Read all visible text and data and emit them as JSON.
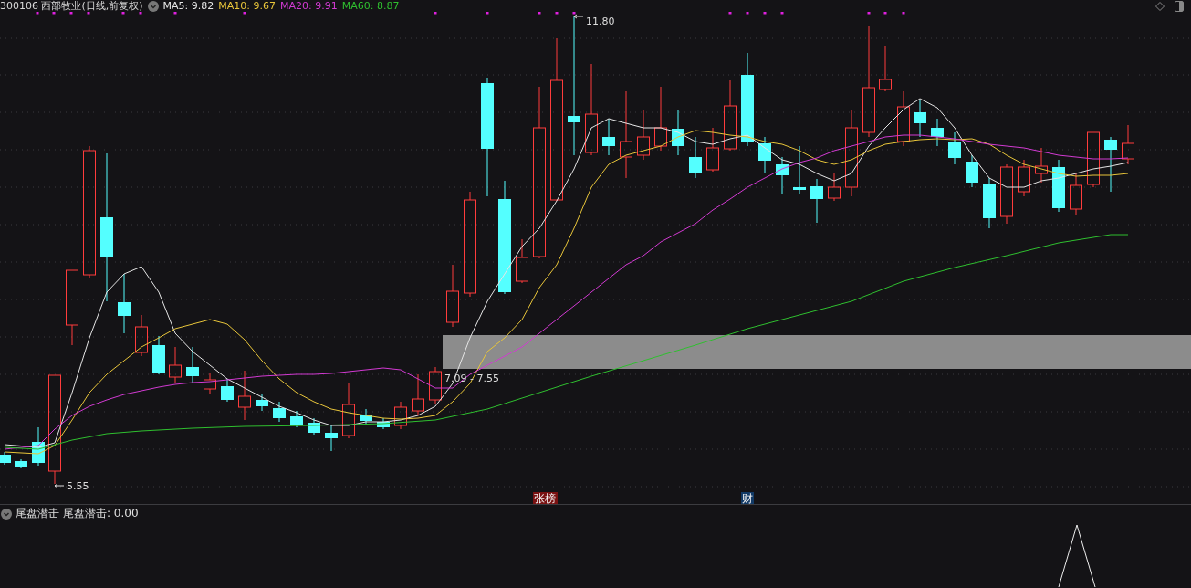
{
  "header": {
    "title": "300106 西部牧业(日线,前复权)",
    "indicators": [
      {
        "label": "MA5: 9.82",
        "color": "#e6e6e6"
      },
      {
        "label": "MA10: 9.67",
        "color": "#e8c53a"
      },
      {
        "label": "MA20: 9.91",
        "color": "#d23ad2"
      },
      {
        "label": "MA60: 8.87",
        "color": "#2fbf2f"
      }
    ]
  },
  "chart": {
    "high_label": "11.80",
    "low_label": "5.55",
    "range_label": "7.09 - 7.55",
    "markers": [
      {
        "text": "张榜",
        "color": "#7a1212"
      },
      {
        "text": "财",
        "color": "#123a66"
      }
    ]
  },
  "sub_panel": {
    "name": "尾盘潜击",
    "reading": "尾盘潜击: 0.00"
  }
}
